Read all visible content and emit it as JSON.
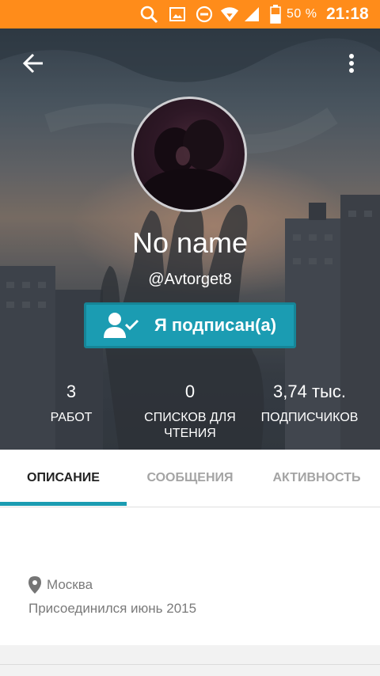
{
  "status_bar": {
    "battery": "50 %",
    "time": "21:18",
    "icons": [
      "search-icon",
      "image-icon",
      "do-not-disturb-icon",
      "wifi-icon",
      "signal-icon",
      "battery-icon"
    ]
  },
  "profile": {
    "display_name": "No name",
    "username": "@Avtorget8",
    "follow_button": "Я подписан(а)",
    "stats": [
      {
        "value": "3",
        "label": "РАБОТ"
      },
      {
        "value": "0",
        "label": "СПИСКОВ ДЛЯ ЧТЕНИЯ"
      },
      {
        "value": "3,74 тыс.",
        "label": "ПОДПИСЧИКОВ"
      }
    ]
  },
  "tabs": [
    {
      "label": "ОПИСАНИЕ",
      "active": true
    },
    {
      "label": "СООБЩЕНИЯ",
      "active": false
    },
    {
      "label": "АКТИВНОСТЬ",
      "active": false
    }
  ],
  "about": {
    "location": "Москва",
    "joined": "Присоединился июнь 2015"
  },
  "colors": {
    "status_bar": "#ff8c1a",
    "accent": "#1b9cb2",
    "text_muted": "#7a7a7a"
  }
}
